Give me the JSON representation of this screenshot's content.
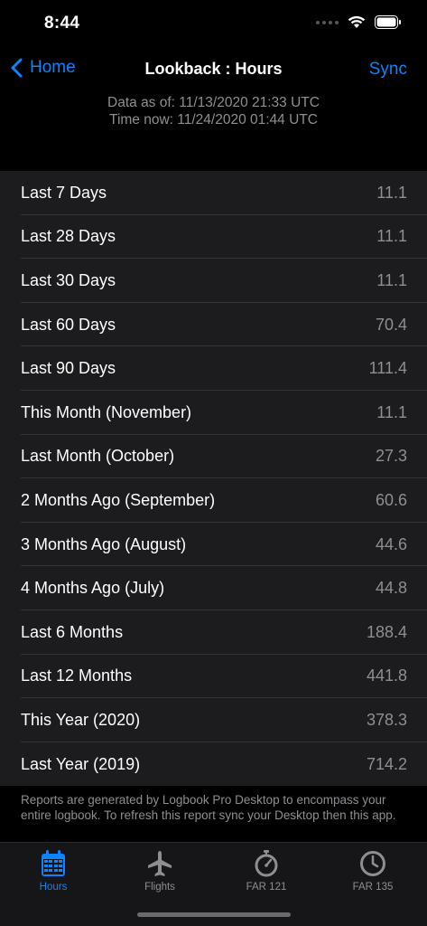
{
  "status": {
    "time": "8:44"
  },
  "nav": {
    "back_label": "Home",
    "title": "Lookback : Hours",
    "sync_label": "Sync"
  },
  "info": {
    "data_as_of": "Data as of: 11/13/2020 21:33 UTC",
    "time_now": "Time now: 11/24/2020 01:44 UTC"
  },
  "rows": [
    {
      "label": "Last 7 Days",
      "value": "11.1"
    },
    {
      "label": "Last 28 Days",
      "value": "11.1"
    },
    {
      "label": "Last 30 Days",
      "value": "11.1"
    },
    {
      "label": "Last 60 Days",
      "value": "70.4"
    },
    {
      "label": "Last 90 Days",
      "value": "111.4"
    },
    {
      "label": "This Month (November)",
      "value": "11.1"
    },
    {
      "label": "Last Month (October)",
      "value": "27.3"
    },
    {
      "label": "2 Months Ago (September)",
      "value": "60.6"
    },
    {
      "label": "3 Months Ago (August)",
      "value": "44.6"
    },
    {
      "label": "4 Months Ago (July)",
      "value": "44.8"
    },
    {
      "label": "Last 6 Months",
      "value": "188.4"
    },
    {
      "label": "Last 12 Months",
      "value": "441.8"
    },
    {
      "label": "This Year (2020)",
      "value": "378.3"
    },
    {
      "label": "Last Year (2019)",
      "value": "714.2"
    }
  ],
  "footer": {
    "note": "Reports are generated by Logbook Pro Desktop to encompass your entire logbook. To refresh this report sync your Desktop then this app."
  },
  "tabs": [
    {
      "label": "Hours",
      "icon": "calendar-icon",
      "active": true
    },
    {
      "label": "Flights",
      "icon": "airplane-icon",
      "active": false
    },
    {
      "label": "FAR 121",
      "icon": "stopwatch-icon",
      "active": false
    },
    {
      "label": "FAR 135",
      "icon": "clock-icon",
      "active": false
    }
  ],
  "colors": {
    "accent": "#0a84ff",
    "background": "#000000",
    "cell": "#1c1c1e",
    "secondary_text": "#8e8e93"
  }
}
